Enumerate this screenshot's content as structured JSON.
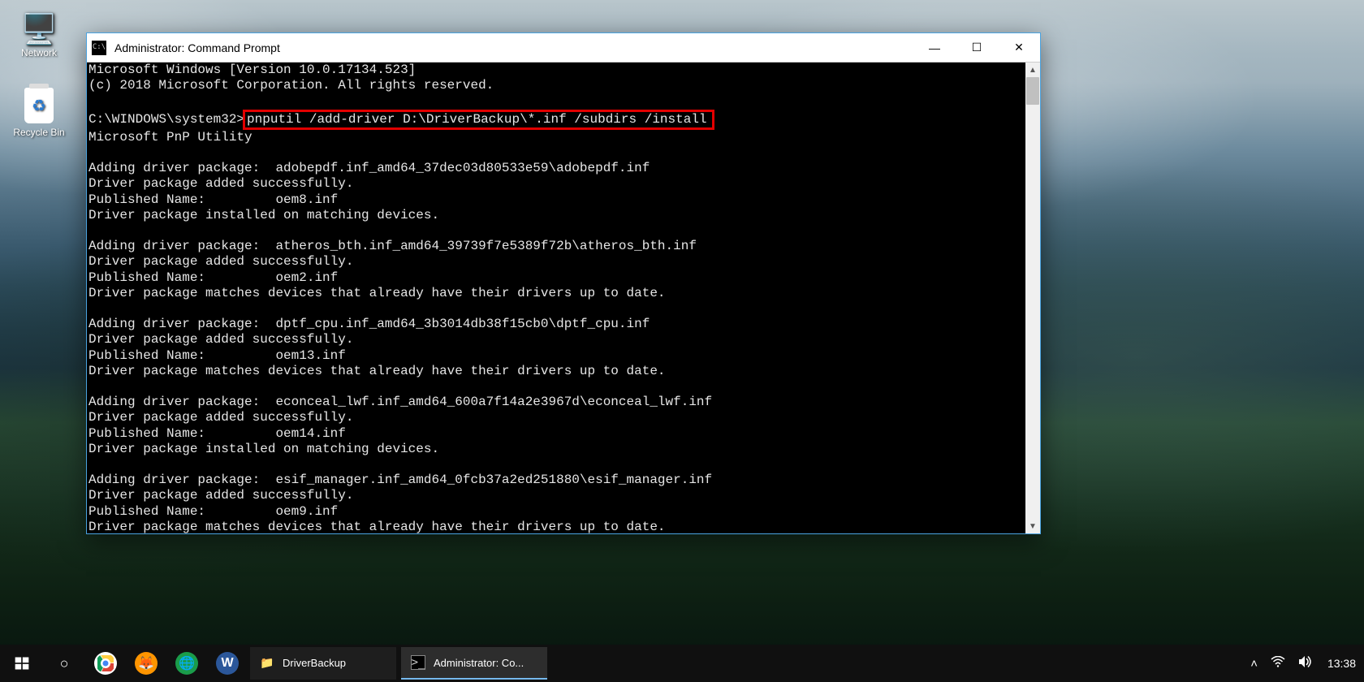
{
  "desktop": {
    "icons": {
      "network": "Network",
      "recycle": "Recycle Bin"
    }
  },
  "window": {
    "title": "Administrator: Command Prompt",
    "minimize": "—",
    "maximize": "☐",
    "close": "✕"
  },
  "console": {
    "header1": "Microsoft Windows [Version 10.0.17134.523]",
    "header2": "(c) 2018 Microsoft Corporation. All rights reserved.",
    "prompt": "C:\\WINDOWS\\system32>",
    "command": "pnputil /add-driver D:\\DriverBackup\\*.inf /subdirs /install",
    "utility": "Microsoft PnP Utility",
    "entries": [
      {
        "add": "Adding driver package:  adobepdf.inf_amd64_37dec03d80533e59\\adobepdf.inf",
        "added": "Driver package added successfully.",
        "pub": "Published Name:         oem8.inf",
        "stat": "Driver package installed on matching devices."
      },
      {
        "add": "Adding driver package:  atheros_bth.inf_amd64_39739f7e5389f72b\\atheros_bth.inf",
        "added": "Driver package added successfully.",
        "pub": "Published Name:         oem2.inf",
        "stat": "Driver package matches devices that already have their drivers up to date."
      },
      {
        "add": "Adding driver package:  dptf_cpu.inf_amd64_3b3014db38f15cb0\\dptf_cpu.inf",
        "added": "Driver package added successfully.",
        "pub": "Published Name:         oem13.inf",
        "stat": "Driver package matches devices that already have their drivers up to date."
      },
      {
        "add": "Adding driver package:  econceal_lwf.inf_amd64_600a7f14a2e3967d\\econceal_lwf.inf",
        "added": "Driver package added successfully.",
        "pub": "Published Name:         oem14.inf",
        "stat": "Driver package installed on matching devices."
      },
      {
        "add": "Adding driver package:  esif_manager.inf_amd64_0fcb37a2ed251880\\esif_manager.inf",
        "added": "Driver package added successfully.",
        "pub": "Published Name:         oem9.inf",
        "stat": "Driver package matches devices that already have their drivers up to date."
      }
    ]
  },
  "taskbar": {
    "explorer": "DriverBackup",
    "cmd": "Administrator: Co...",
    "clock": "13:38",
    "chevron": "˄"
  }
}
